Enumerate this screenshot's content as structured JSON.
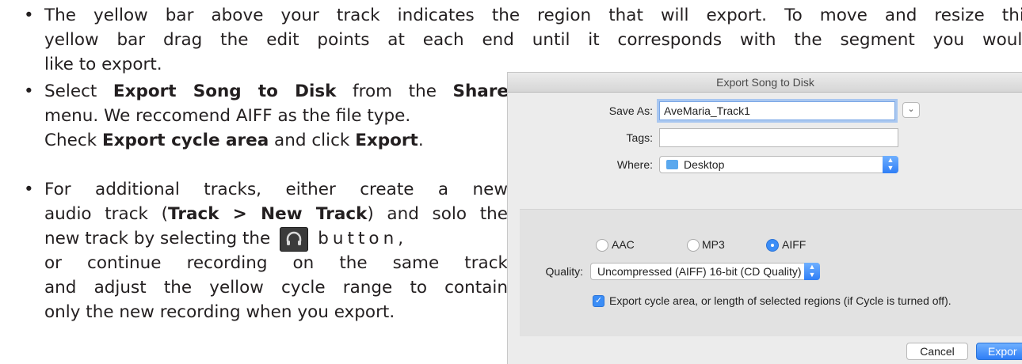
{
  "instructions": {
    "bullet_glyph": "•",
    "item1": {
      "line1": "The yellow bar above your track indicates the region that will export. To move and resize this",
      "line2": "yellow bar drag the edit points at each end until it corresponds with the segment you would",
      "line3": "like to export."
    },
    "item2": {
      "select": "Select ",
      "export_song": "Export Song to Disk",
      "from_the": " from the ",
      "share": "Share",
      "menu_line": "menu. We reccomend AIFF as the file type.",
      "check": "Check ",
      "export_cycle": "Export cycle area",
      "and_click": " and click ",
      "export": "Export",
      "period": "."
    },
    "item3": {
      "line1": "For additional tracks, either create a new",
      "audio_track": "audio track (",
      "track_new": "Track > New Track",
      "and_solo": ") and solo the",
      "new_track_by": "new track by selecting the",
      "button_word": "button,",
      "line4": "or continue recording on the same track",
      "line5": "and adjust the yellow cycle range to contain",
      "line6": "only the new recording when you export."
    }
  },
  "dialog": {
    "title": "Export Song to Disk",
    "save_as_label": "Save As:",
    "save_as_value": "AveMaria_Track1",
    "tags_label": "Tags:",
    "tags_value": "",
    "where_label": "Where:",
    "where_value": "Desktop",
    "formats": [
      {
        "label": "AAC",
        "selected": false
      },
      {
        "label": "MP3",
        "selected": false
      },
      {
        "label": "AIFF",
        "selected": true
      }
    ],
    "quality_label": "Quality:",
    "quality_value": "Uncompressed (AIFF) 16-bit (CD Quality)",
    "cycle_checkbox_label": "Export cycle area, or length of selected regions (if Cycle is turned off).",
    "cycle_checked": true,
    "cancel_label": "Cancel",
    "export_label": "Expor",
    "accent_color": "#3b8df6"
  }
}
